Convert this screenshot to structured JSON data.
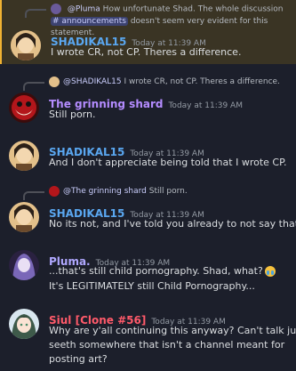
{
  "colors": {
    "shadikal": "#5aa7f0",
    "grinning": "#b48cff",
    "pluma": "#b0a8ff",
    "siul": "#ff5a6a",
    "highlight_bar": "#f0b232"
  },
  "messages": [
    {
      "id": "m1",
      "reply_to": {
        "author": "@Pluma",
        "text_before": "How unfortunate Shad. The whole discussion ",
        "channel": "# announcements",
        "text_after": " doesn't seem very evident for this statement."
      },
      "author": "SHADIKAL15",
      "time": "Today at 11:39 AM",
      "lines": [
        "I wrote CR, not CP. Theres a difference."
      ],
      "avatar_icon": "portrait-avatar-icon"
    },
    {
      "id": "m2",
      "reply_to": {
        "author": "@SHADIKAL15",
        "text": "I wrote CR, not CP. Theres a difference."
      },
      "author": "The grinning shard",
      "time": "Today at 11:39 AM",
      "lines": [
        "Still porn."
      ],
      "avatar_icon": "red-mask-avatar-icon"
    },
    {
      "id": "m3",
      "author": "SHADIKAL15",
      "time": "Today at 11:39 AM",
      "lines": [
        "And I don't appreciate being told that I wrote CP."
      ],
      "avatar_icon": "portrait-avatar-icon"
    },
    {
      "id": "m4",
      "reply_to": {
        "author": "@The grinning shard",
        "text": "Still porn."
      },
      "author": "SHADIKAL15",
      "time": "Today at 11:39 AM",
      "lines": [
        "No its not, and I've told you already to not say that."
      ],
      "avatar_icon": "portrait-avatar-icon"
    },
    {
      "id": "m5",
      "author": "Pluma.",
      "time": "Today at 11:39 AM",
      "lines": [
        "...that's still child pornography. Shad, what?",
        "It's LEGITIMATELY still Child Pornography..."
      ],
      "emoji": "crying-face-emoji",
      "avatar_icon": "purple-character-avatar-icon"
    },
    {
      "id": "m6",
      "author": "Siul [Clone #56]",
      "time": "Today at 11:39 AM",
      "lines": [
        "Why are y'all continuing this anyway? Can't talk just",
        "seeth somewhere that isn't a channel meant for",
        "posting art?"
      ],
      "avatar_icon": "anime-avatar-icon"
    }
  ]
}
